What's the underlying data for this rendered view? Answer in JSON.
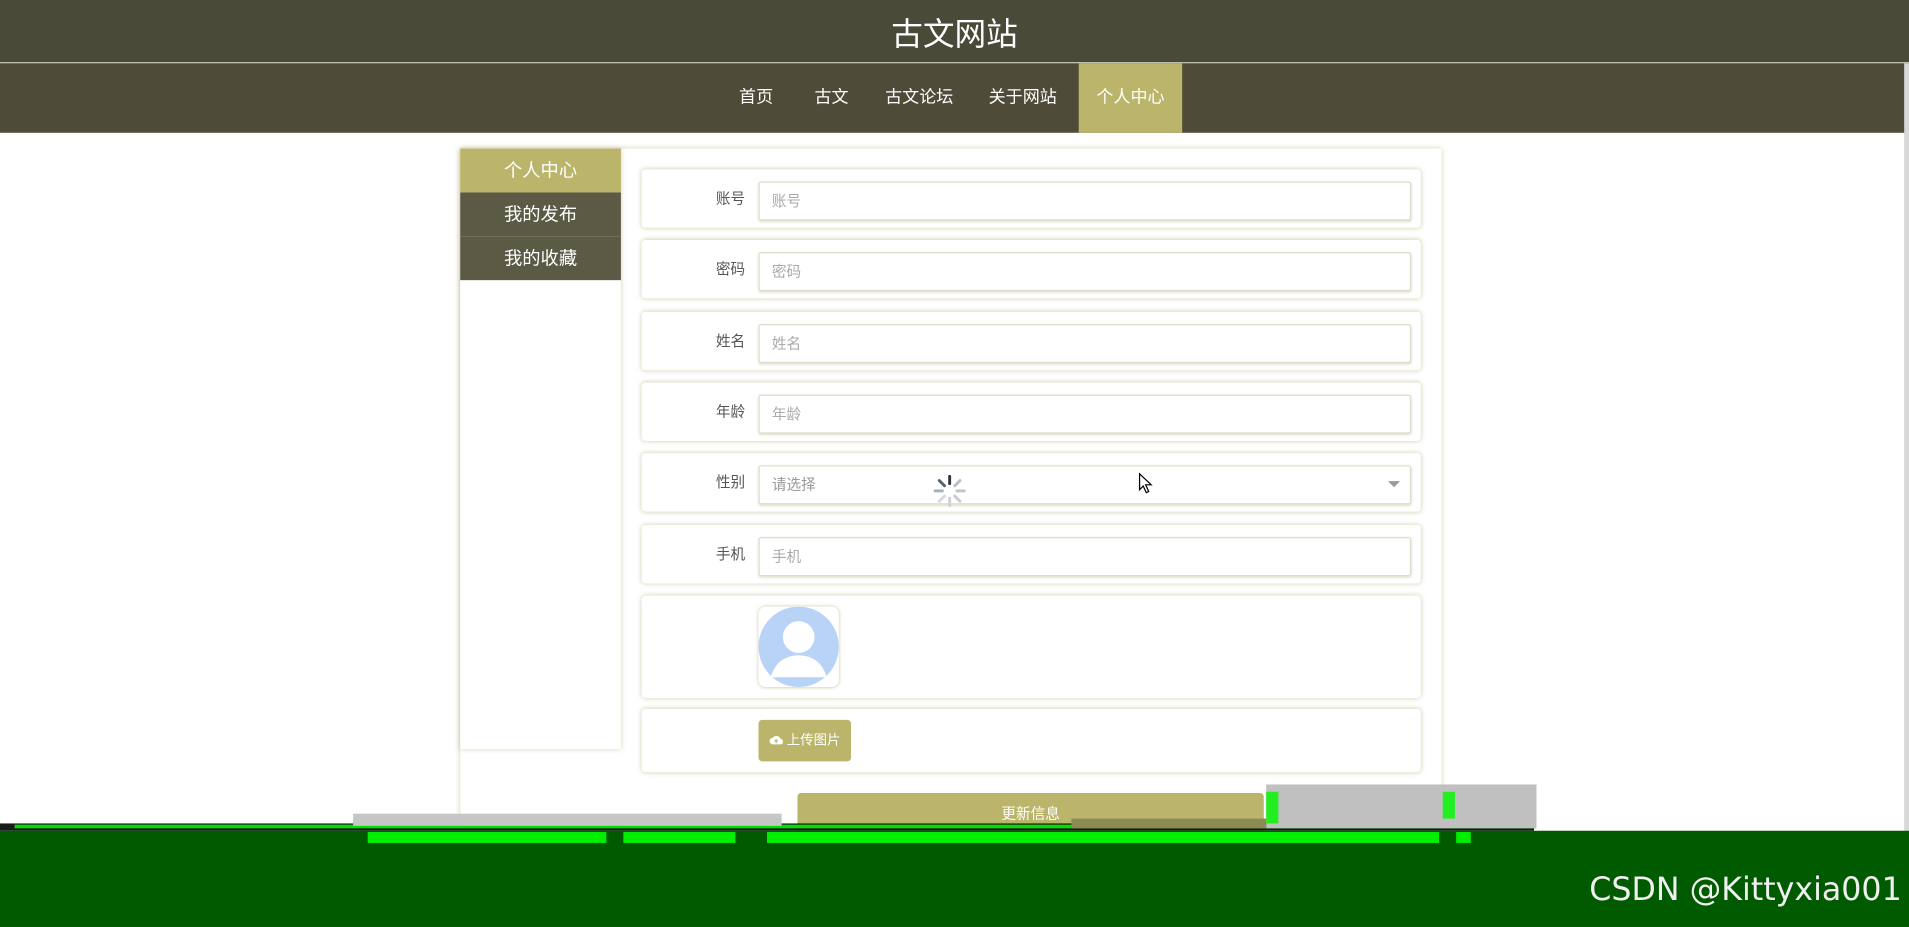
{
  "header": {
    "site_title": "古文网站"
  },
  "nav": {
    "items": [
      {
        "label": "首页"
      },
      {
        "label": "古文"
      },
      {
        "label": "古文论坛"
      },
      {
        "label": "关于网站"
      },
      {
        "label": "个人中心",
        "active": true
      }
    ]
  },
  "sidebar": {
    "items": [
      {
        "label": "个人中心",
        "active": true
      },
      {
        "label": "我的发布"
      },
      {
        "label": "我的收藏"
      }
    ]
  },
  "form": {
    "account": {
      "label": "账号",
      "placeholder": "账号",
      "value": ""
    },
    "password": {
      "label": "密码",
      "placeholder": "密码",
      "value": ""
    },
    "name": {
      "label": "姓名",
      "placeholder": "姓名",
      "value": ""
    },
    "age": {
      "label": "年龄",
      "placeholder": "年龄",
      "value": ""
    },
    "gender": {
      "label": "性别",
      "selected": "请选择"
    },
    "phone": {
      "label": "手机",
      "placeholder": "手机",
      "value": ""
    },
    "upload_label": "上传图片",
    "submit_label": "更新信息"
  },
  "icons": {
    "avatar": "avatar-placeholder-icon",
    "upload": "cloud-upload-icon",
    "select": "chevron-down-icon",
    "loading": "loading-spinner-icon",
    "cursor": "mouse-pointer-icon"
  },
  "colors": {
    "header_bg": "#4a4a39",
    "nav_active": "#bab56b",
    "sidebar_inactive": "#5b5a45",
    "accent": "#bab56b",
    "bottom_band": "#005a00"
  },
  "watermark": "CSDN @Kittyxia001"
}
